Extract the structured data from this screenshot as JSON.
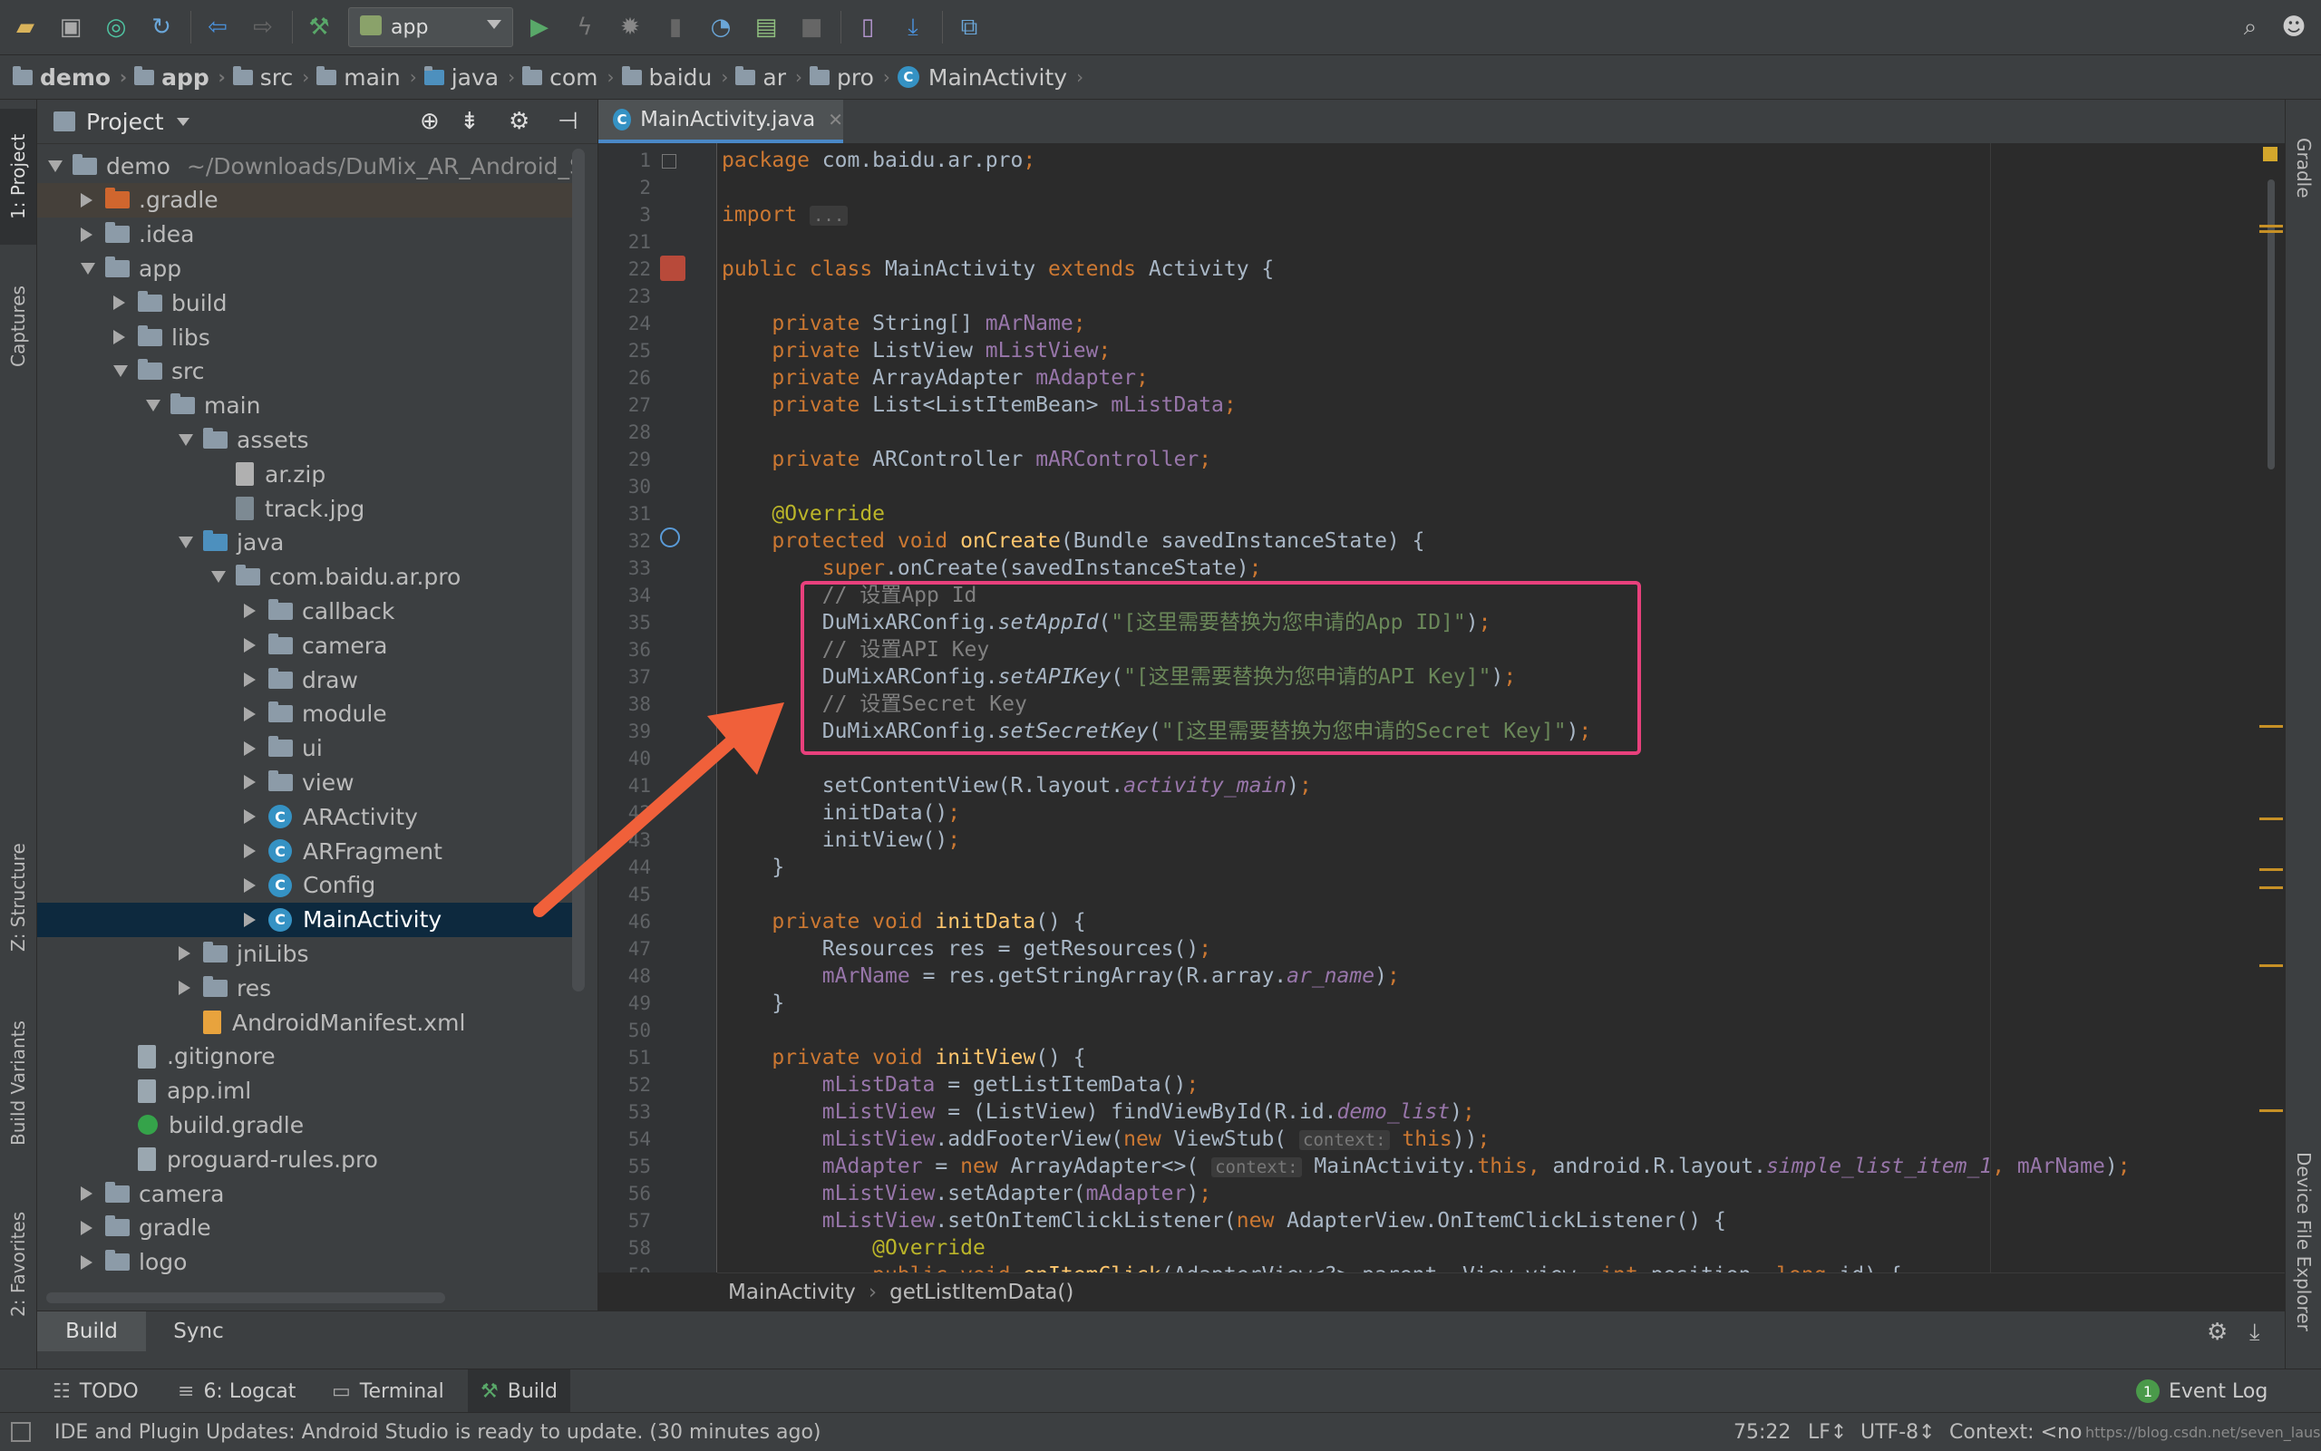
{
  "toolbar": {
    "run_config": "app",
    "icons": [
      "open-folder-icon",
      "save-icon",
      "sync-icon",
      "refresh-icon",
      "back-icon",
      "forward-icon",
      "build-hammer-icon",
      "run-icon",
      "apply-changes-icon",
      "debug-icon",
      "profile-icon",
      "attach-debugger-icon",
      "run-coverage-icon",
      "stop-icon",
      "avd-manager-icon",
      "sdk-manager-icon",
      "layout-inspector-icon",
      "search-icon",
      "user-icon"
    ]
  },
  "breadcrumb": [
    {
      "label": "demo"
    },
    {
      "label": "app"
    },
    {
      "label": "src"
    },
    {
      "label": "main"
    },
    {
      "label": "java"
    },
    {
      "label": "com"
    },
    {
      "label": "baidu"
    },
    {
      "label": "ar"
    },
    {
      "label": "pro"
    },
    {
      "label": "MainActivity"
    }
  ],
  "left_strip": {
    "project": "1: Project",
    "captures": "Captures",
    "structure": "Z: Structure",
    "build_variants": "Build Variants",
    "favorites": "2: Favorites"
  },
  "right_strip": {
    "gradle": "Gradle",
    "device_file_explorer": "Device File Explorer"
  },
  "project": {
    "title": "Project",
    "tree": [
      {
        "label": "demo",
        "path": "~/Downloads/DuMix_AR_Android_S",
        "depth": 0,
        "state": "open",
        "icon": "folder"
      },
      {
        "label": ".gradle",
        "depth": 1,
        "state": "closed",
        "icon": "folder-orange",
        "style": "gradle"
      },
      {
        "label": ".idea",
        "depth": 1,
        "state": "closed",
        "icon": "folder"
      },
      {
        "label": "app",
        "depth": 1,
        "state": "open",
        "icon": "folder"
      },
      {
        "label": "build",
        "depth": 2,
        "state": "closed",
        "icon": "folder"
      },
      {
        "label": "libs",
        "depth": 2,
        "state": "closed",
        "icon": "folder"
      },
      {
        "label": "src",
        "depth": 2,
        "state": "open",
        "icon": "folder"
      },
      {
        "label": "main",
        "depth": 3,
        "state": "open",
        "icon": "folder"
      },
      {
        "label": "assets",
        "depth": 4,
        "state": "open",
        "icon": "folder"
      },
      {
        "label": "ar.zip",
        "depth": 5,
        "state": "none",
        "icon": "zip"
      },
      {
        "label": "track.jpg",
        "depth": 5,
        "state": "none",
        "icon": "img"
      },
      {
        "label": "java",
        "depth": 4,
        "state": "open",
        "icon": "folder-blue"
      },
      {
        "label": "com.baidu.ar.pro",
        "depth": 5,
        "state": "open",
        "icon": "folder"
      },
      {
        "label": "callback",
        "depth": 6,
        "state": "closed",
        "icon": "folder"
      },
      {
        "label": "camera",
        "depth": 6,
        "state": "closed",
        "icon": "folder"
      },
      {
        "label": "draw",
        "depth": 6,
        "state": "closed",
        "icon": "folder"
      },
      {
        "label": "module",
        "depth": 6,
        "state": "closed",
        "icon": "folder"
      },
      {
        "label": "ui",
        "depth": 6,
        "state": "closed",
        "icon": "folder"
      },
      {
        "label": "view",
        "depth": 6,
        "state": "closed",
        "icon": "folder"
      },
      {
        "label": "ARActivity",
        "depth": 6,
        "state": "closed",
        "icon": "class"
      },
      {
        "label": "ARFragment",
        "depth": 6,
        "state": "closed",
        "icon": "class"
      },
      {
        "label": "Config",
        "depth": 6,
        "state": "closed",
        "icon": "class"
      },
      {
        "label": "MainActivity",
        "depth": 6,
        "state": "closed",
        "icon": "class",
        "style": "sel"
      },
      {
        "label": "jniLibs",
        "depth": 4,
        "state": "closed",
        "icon": "folder"
      },
      {
        "label": "res",
        "depth": 4,
        "state": "closed",
        "icon": "folder"
      },
      {
        "label": "AndroidManifest.xml",
        "depth": 4,
        "state": "none",
        "icon": "xml"
      },
      {
        "label": ".gitignore",
        "depth": 2,
        "state": "none",
        "icon": "file"
      },
      {
        "label": "app.iml",
        "depth": 2,
        "state": "none",
        "icon": "file"
      },
      {
        "label": "build.gradle",
        "depth": 2,
        "state": "none",
        "icon": "gradle"
      },
      {
        "label": "proguard-rules.pro",
        "depth": 2,
        "state": "none",
        "icon": "file"
      },
      {
        "label": "camera",
        "depth": 1,
        "state": "closed",
        "icon": "folder"
      },
      {
        "label": "gradle",
        "depth": 1,
        "state": "closed",
        "icon": "folder"
      },
      {
        "label": "logo",
        "depth": 1,
        "state": "closed",
        "icon": "folder"
      }
    ]
  },
  "editor": {
    "tab": "MainActivity.java",
    "line_numbers": [
      "1",
      "2",
      "3",
      "21",
      "22",
      "23",
      "24",
      "25",
      "26",
      "27",
      "28",
      "29",
      "30",
      "31",
      "32",
      "33",
      "34",
      "35",
      "36",
      "37",
      "38",
      "39",
      "40",
      "41",
      "42",
      "43",
      "44",
      "45",
      "46",
      "47",
      "48",
      "49",
      "50",
      "51",
      "52",
      "53",
      "54",
      "55",
      "56",
      "57",
      "58",
      "59"
    ],
    "lines": [
      [
        [
          "kw",
          "package "
        ],
        [
          "",
          "com.baidu.ar.pro"
        ],
        [
          "kw",
          ";"
        ]
      ],
      [],
      [
        [
          "kw",
          "import "
        ],
        [
          "hint",
          "..."
        ]
      ],
      [],
      [
        [
          "kw",
          "public class "
        ],
        [
          "",
          "MainActivity "
        ],
        [
          "kw",
          "extends "
        ],
        [
          "",
          "Activity {"
        ]
      ],
      [],
      [
        [
          "",
          "    "
        ],
        [
          "kw",
          "private "
        ],
        [
          "",
          "String[] "
        ],
        [
          "fld",
          "mArName"
        ],
        [
          "kw",
          ";"
        ]
      ],
      [
        [
          "",
          "    "
        ],
        [
          "kw",
          "private "
        ],
        [
          "",
          "ListView "
        ],
        [
          "fld",
          "mListView"
        ],
        [
          "kw",
          ";"
        ]
      ],
      [
        [
          "",
          "    "
        ],
        [
          "kw",
          "private "
        ],
        [
          "",
          "ArrayAdapter "
        ],
        [
          "fld",
          "mAdapter"
        ],
        [
          "kw",
          ";"
        ]
      ],
      [
        [
          "",
          "    "
        ],
        [
          "kw",
          "private "
        ],
        [
          "",
          "List<ListItemBean> "
        ],
        [
          "fld",
          "mListData"
        ],
        [
          "kw",
          ";"
        ]
      ],
      [],
      [
        [
          "",
          "    "
        ],
        [
          "kw",
          "private "
        ],
        [
          "",
          "ARController "
        ],
        [
          "fld",
          "mARController"
        ],
        [
          "kw",
          ";"
        ]
      ],
      [],
      [
        [
          "",
          "    "
        ],
        [
          "ann",
          "@Override"
        ]
      ],
      [
        [
          "",
          "    "
        ],
        [
          "kw",
          "protected void "
        ],
        [
          "mth",
          "onCreate"
        ],
        [
          "",
          "(Bundle savedInstanceState) {"
        ]
      ],
      [
        [
          "",
          "        "
        ],
        [
          "kw",
          "super"
        ],
        [
          "",
          "."
        ],
        [
          "",
          "onCreate(savedInstanceState)"
        ],
        [
          "kw",
          ";"
        ]
      ],
      [
        [
          "",
          "        "
        ],
        [
          "cmt",
          "// 设置App Id"
        ]
      ],
      [
        [
          "",
          "        "
        ],
        [
          "",
          "DuMixARConfig."
        ],
        [
          "it",
          "setAppId"
        ],
        [
          "",
          "("
        ],
        [
          "str",
          "\"[这里需要替换为您申请的App ID]\""
        ],
        [
          "",
          ")"
        ],
        [
          "kw",
          ";"
        ]
      ],
      [
        [
          "",
          "        "
        ],
        [
          "cmt",
          "// 设置API Key"
        ]
      ],
      [
        [
          "",
          "        "
        ],
        [
          "",
          "DuMixARConfig."
        ],
        [
          "it",
          "setAPIKey"
        ],
        [
          "",
          "("
        ],
        [
          "str",
          "\"[这里需要替换为您申请的API Key]\""
        ],
        [
          "",
          ")"
        ],
        [
          "kw",
          ";"
        ]
      ],
      [
        [
          "",
          "        "
        ],
        [
          "cmt",
          "// 设置Secret Key"
        ]
      ],
      [
        [
          "",
          "        "
        ],
        [
          "",
          "DuMixARConfig."
        ],
        [
          "it",
          "setSecretKey"
        ],
        [
          "",
          "("
        ],
        [
          "str",
          "\"[这里需要替换为您申请的Secret Key]\""
        ],
        [
          "",
          ")"
        ],
        [
          "kw",
          ";"
        ]
      ],
      [],
      [
        [
          "",
          "        setContentView(R.layout."
        ],
        [
          "fldi",
          "activity_main"
        ],
        [
          "",
          ")"
        ],
        [
          "kw",
          ";"
        ]
      ],
      [
        [
          "",
          "        initData()"
        ],
        [
          "kw",
          ";"
        ]
      ],
      [
        [
          "",
          "        initView()"
        ],
        [
          "kw",
          ";"
        ]
      ],
      [
        [
          "",
          "    }"
        ]
      ],
      [],
      [
        [
          "",
          "    "
        ],
        [
          "kw",
          "private void "
        ],
        [
          "mth",
          "initData"
        ],
        [
          "",
          "() {"
        ]
      ],
      [
        [
          "",
          "        Resources res = getResources()"
        ],
        [
          "kw",
          ";"
        ]
      ],
      [
        [
          "",
          "        "
        ],
        [
          "fld",
          "mArName"
        ],
        [
          "",
          " = res.getStringArray(R.array."
        ],
        [
          "fldi",
          "ar_name"
        ],
        [
          "",
          ")"
        ],
        [
          "kw",
          ";"
        ]
      ],
      [
        [
          "",
          "    }"
        ]
      ],
      [],
      [
        [
          "",
          "    "
        ],
        [
          "kw",
          "private void "
        ],
        [
          "mth",
          "initView"
        ],
        [
          "",
          "() {"
        ]
      ],
      [
        [
          "",
          "        "
        ],
        [
          "fld",
          "mListData"
        ],
        [
          "",
          " = getListItemData()"
        ],
        [
          "kw",
          ";"
        ]
      ],
      [
        [
          "",
          "        "
        ],
        [
          "fld",
          "mListView"
        ],
        [
          "",
          " = (ListView) findViewById(R.id."
        ],
        [
          "fldi",
          "demo_list"
        ],
        [
          "",
          ")"
        ],
        [
          "kw",
          ";"
        ]
      ],
      [
        [
          "",
          "        "
        ],
        [
          "fld",
          "mListView"
        ],
        [
          "",
          ".addFooterView("
        ],
        [
          "kw",
          "new "
        ],
        [
          "",
          "ViewStub( "
        ],
        [
          "hint",
          "context:"
        ],
        [
          "",
          " "
        ],
        [
          "kw",
          "this"
        ],
        [
          "",
          "))"
        ],
        [
          "kw",
          ";"
        ]
      ],
      [
        [
          "",
          "        "
        ],
        [
          "fld",
          "mAdapter"
        ],
        [
          "",
          " = "
        ],
        [
          "kw",
          "new "
        ],
        [
          "",
          "ArrayAdapter<>( "
        ],
        [
          "hint",
          "context:"
        ],
        [
          "",
          " MainActivity."
        ],
        [
          "kw",
          "this, "
        ],
        [
          "",
          "android.R.layout."
        ],
        [
          "fldi",
          "simple_list_item_1"
        ],
        [
          "kw",
          ", "
        ],
        [
          "fld",
          "mArName"
        ],
        [
          "",
          ")"
        ],
        [
          "kw",
          ";"
        ]
      ],
      [
        [
          "",
          "        "
        ],
        [
          "fld",
          "mListView"
        ],
        [
          "",
          ".setAdapter("
        ],
        [
          "fld",
          "mAdapter"
        ],
        [
          "",
          ")"
        ],
        [
          "kw",
          ";"
        ]
      ],
      [
        [
          "",
          "        "
        ],
        [
          "fld",
          "mListView"
        ],
        [
          "",
          ".setOnItemClickListener("
        ],
        [
          "kw",
          "new "
        ],
        [
          "",
          "AdapterView.OnItemClickListener() {"
        ]
      ],
      [
        [
          "",
          "            "
        ],
        [
          "ann",
          "@Override"
        ]
      ],
      [
        [
          "",
          "            "
        ],
        [
          "kw",
          "public void "
        ],
        [
          "mth",
          "onItemClick"
        ],
        [
          "",
          "(AdapterView<?> parent, View view, "
        ],
        [
          "kw",
          "int "
        ],
        [
          "",
          "position, "
        ],
        [
          "kw",
          "long "
        ],
        [
          "",
          "id) {"
        ]
      ]
    ],
    "breadcrumb": [
      "MainActivity",
      "getListItemData()"
    ]
  },
  "build_panel": {
    "tabs": [
      "Build",
      "Sync"
    ]
  },
  "bottom_tabs": {
    "todo": "TODO",
    "logcat": "6: Logcat",
    "terminal": "Terminal",
    "build": "Build",
    "event_log": "Event Log",
    "event_count": "1"
  },
  "status": {
    "message": "IDE and Plugin Updates: Android Studio is ready to update. (30 minutes ago)",
    "position": "75:22",
    "line_sep": "LF↕",
    "encoding": "UTF-8↕",
    "context": "Context: <no context>",
    "watermark": "https://blog.csdn.net/seven_lauseon"
  }
}
